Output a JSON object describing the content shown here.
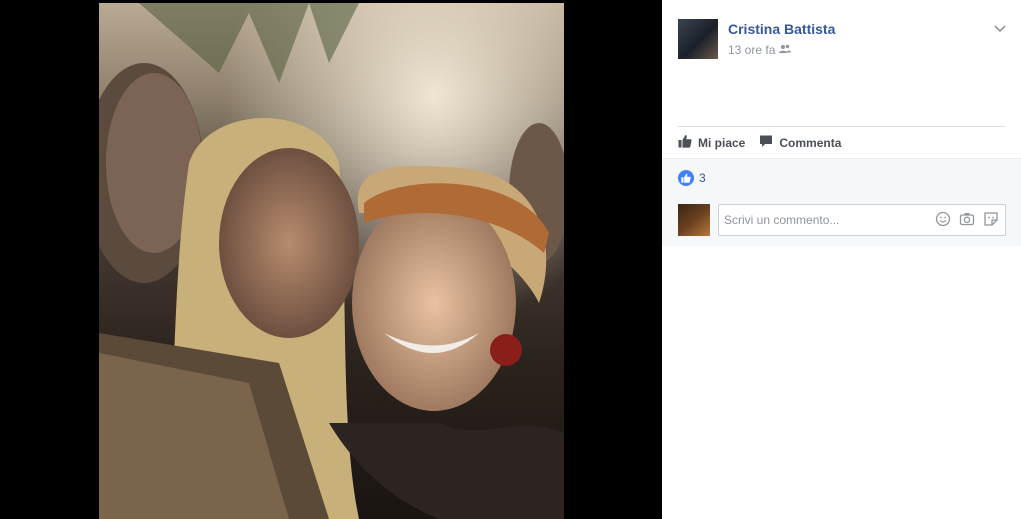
{
  "post": {
    "author": "Cristina Battista",
    "time": "13 ore fa",
    "audience_icon": "friends-icon",
    "options_icon": "chevron-down-icon"
  },
  "actions": {
    "like_label": "Mi piace",
    "comment_label": "Commenta"
  },
  "reactions": {
    "like_count": "3"
  },
  "comment_box": {
    "placeholder": "Scrivi un commento..."
  },
  "colors": {
    "author_link": "#365899",
    "like_blue": "#4080ff",
    "panel_bg": "#f6f7f9"
  }
}
